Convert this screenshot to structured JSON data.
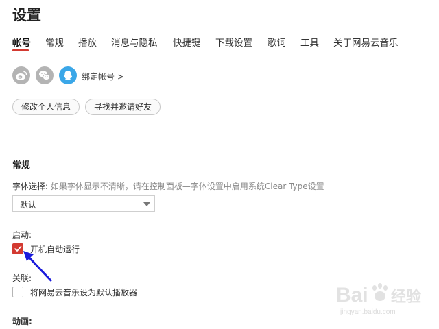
{
  "page": {
    "title": "设置"
  },
  "tabs": [
    {
      "label": "帐号",
      "active": true
    },
    {
      "label": "常规"
    },
    {
      "label": "播放"
    },
    {
      "label": "消息与隐私"
    },
    {
      "label": "快捷键"
    },
    {
      "label": "下载设置"
    },
    {
      "label": "歌词"
    },
    {
      "label": "工具"
    },
    {
      "label": "关于网易云音乐"
    }
  ],
  "account": {
    "social_icons": [
      "weibo-icon",
      "wechat-icon",
      "qq-icon"
    ],
    "bind_label": "绑定帐号 >",
    "edit_profile": "修改个人信息",
    "invite_friends": "寻找并邀请好友"
  },
  "general": {
    "section_title": "常规",
    "font_label": "字体选择:",
    "font_hint": "如果字体显示不清晰，请在控制面板—字体设置中启用系统Clear Type设置",
    "font_value": "默认",
    "startup_label": "启动:",
    "autostart_label": "开机自动运行",
    "autostart_checked": true,
    "association_label": "关联:",
    "default_player_label": "将网易云音乐设为默认播放器",
    "default_player_checked": false,
    "animation_label": "动画:"
  },
  "colors": {
    "accent": "#d33a31",
    "annotation_arrow": "#1a1adc"
  },
  "watermark": {
    "text": "Baidu经验",
    "url": "jingyan.baidu.com"
  }
}
